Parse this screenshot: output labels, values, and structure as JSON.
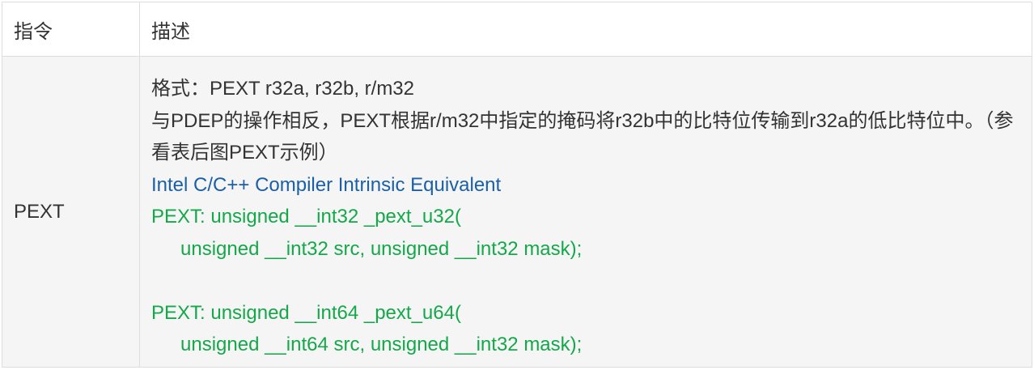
{
  "table": {
    "header": {
      "col1": "指令",
      "col2": "描述"
    },
    "row": {
      "instruction": "PEXT",
      "format": "格式：PEXT r32a, r32b, r/m32",
      "description": "与PDEP的操作相反，PEXT根据r/m32中指定的掩码将r32b中的比特位传输到r32a的低比特位中。（参看表后图PEXT示例）",
      "intrinsic_heading": "Intel C/C++ Compiler Intrinsic Equivalent",
      "code": [
        "PEXT: unsigned __int32 _pext_u32(",
        "unsigned __int32 src, unsigned __int32 mask);",
        "PEXT: unsigned __int64 _pext_u64(",
        "unsigned __int64 src, unsigned __int32 mask);"
      ]
    }
  },
  "colors": {
    "border": "#dddddd",
    "row_bg": "#f5f5f5",
    "text": "#333333",
    "heading_blue": "#1a5fa8",
    "code_green": "#14a84a"
  }
}
